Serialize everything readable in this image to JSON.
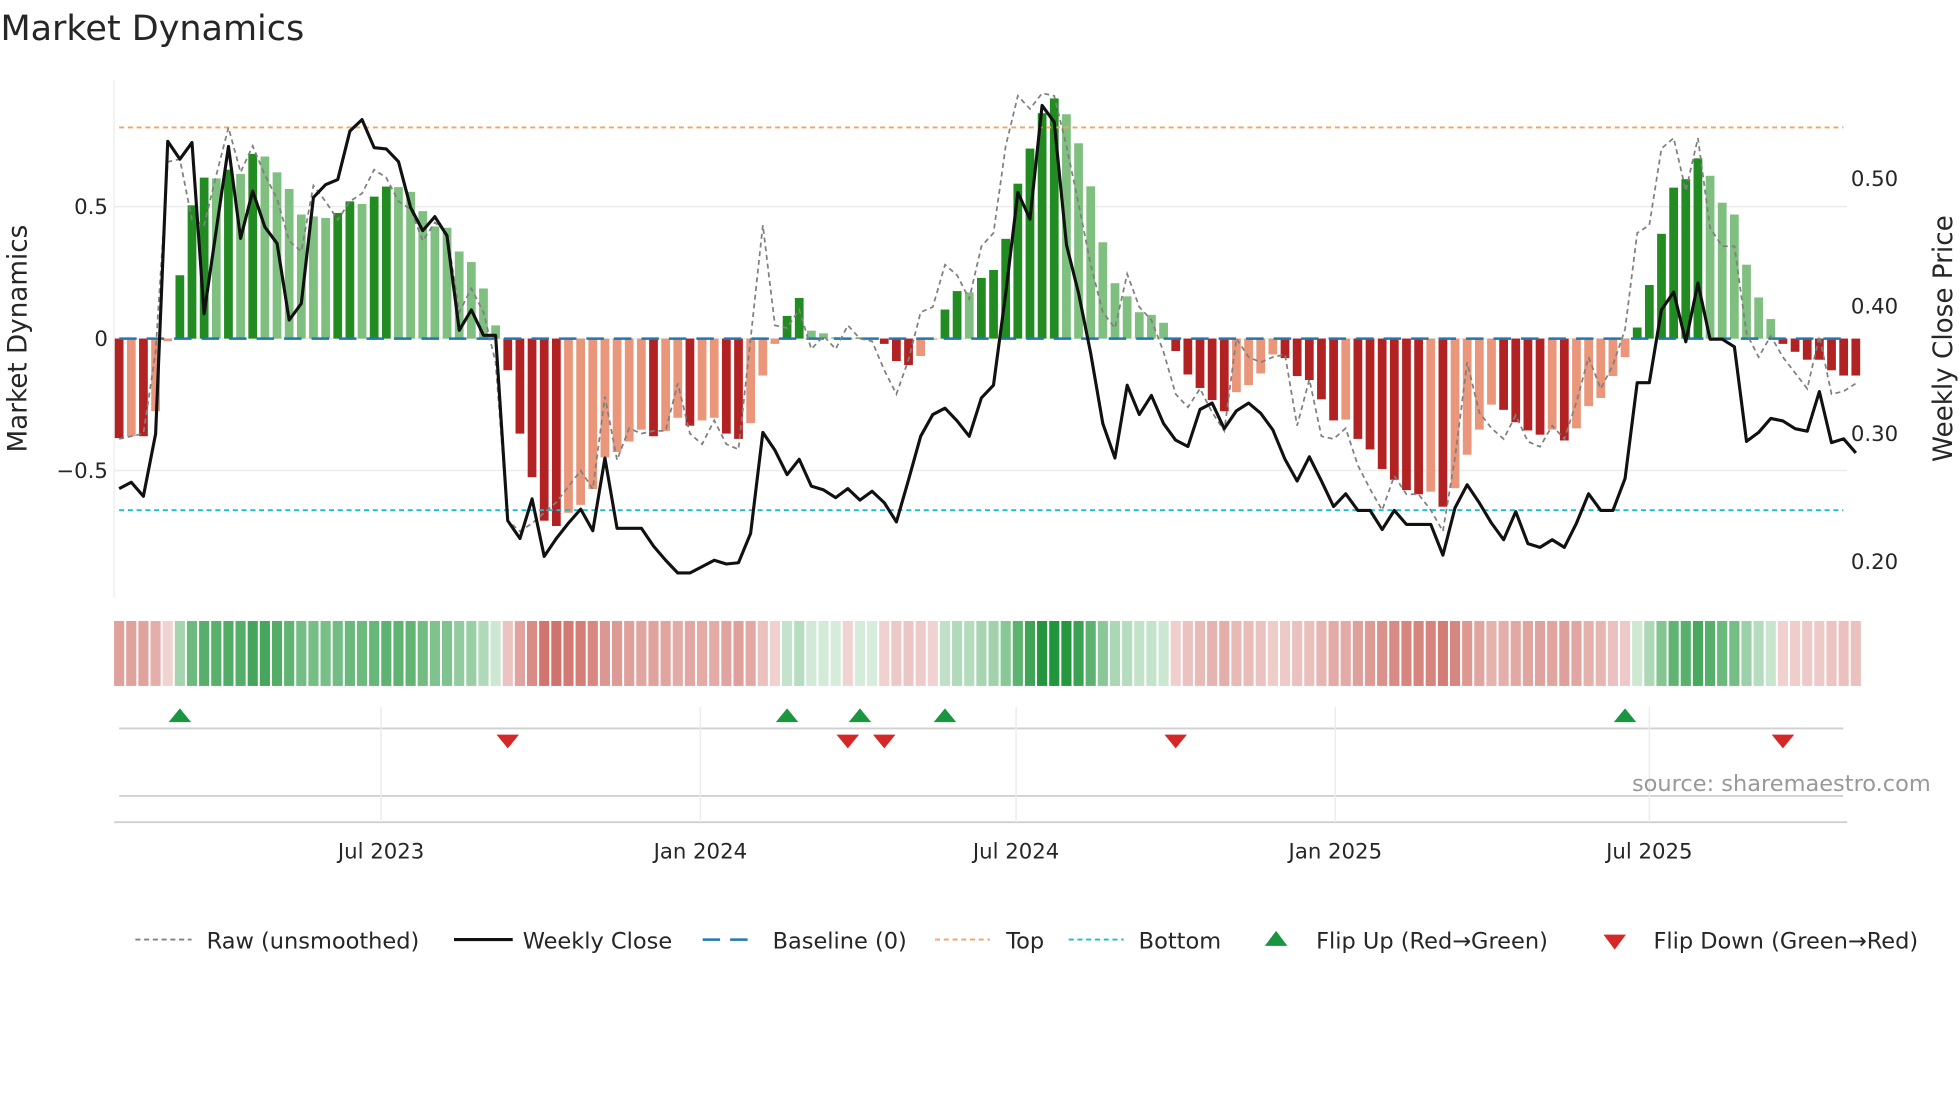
{
  "chart_data": {
    "type": "bar",
    "title": "Market Dynamics",
    "ylabel": "Market Dynamics",
    "y2label": "Weekly Close Price",
    "source": "source: sharemaestro.com",
    "x_start": "2023-01-31",
    "x_step_days": 7,
    "ylim": [
      -0.98,
      0.98
    ],
    "y2lim": [
      0.172,
      0.577
    ],
    "yticks": [
      {
        "v": 0.5,
        "label": "0.5"
      },
      {
        "v": 0,
        "label": "0"
      },
      {
        "v": -0.5,
        "label": "−0.5"
      }
    ],
    "y2ticks": [
      {
        "v": 0.5,
        "label": "0.50"
      },
      {
        "v": 0.4,
        "label": "0.40"
      },
      {
        "v": 0.3,
        "label": "0.30"
      },
      {
        "v": 0.2,
        "label": "0.20"
      }
    ],
    "xticks": [
      {
        "date": "2023-07-01",
        "label": "Jul 2023"
      },
      {
        "date": "2024-01-01",
        "label": "Jan 2024"
      },
      {
        "date": "2024-07-01",
        "label": "Jul 2024"
      },
      {
        "date": "2025-01-01",
        "label": "Jan 2025"
      },
      {
        "date": "2025-07-01",
        "label": "Jul 2025"
      }
    ],
    "top_level": 0.8,
    "bottom_level": -0.65,
    "baseline": 0,
    "colors": {
      "up_strong": "#228b22",
      "up_weak": "#7fbf7f",
      "down_strong": "#b22222",
      "down_weak": "#e9967a",
      "top": "#f4a460",
      "bottom": "#17becf",
      "baseline": "#1f77b4",
      "flip_up": "#1a9641",
      "flip_down": "#d62728"
    },
    "dynamics": [
      -0.377,
      -0.37,
      -0.37,
      -0.275,
      -0.01,
      0.24,
      0.505,
      0.61,
      0.607,
      0.64,
      0.624,
      0.7,
      0.69,
      0.63,
      0.567,
      0.47,
      0.463,
      0.457,
      0.476,
      0.52,
      0.51,
      0.538,
      0.576,
      0.574,
      0.556,
      0.483,
      0.425,
      0.42,
      0.33,
      0.29,
      0.19,
      0.05,
      -0.12,
      -0.36,
      -0.525,
      -0.69,
      -0.71,
      -0.66,
      -0.63,
      -0.57,
      -0.45,
      -0.43,
      -0.39,
      -0.345,
      -0.37,
      -0.35,
      -0.3,
      -0.33,
      -0.31,
      -0.3,
      -0.36,
      -0.38,
      -0.32,
      -0.14,
      -0.02,
      0.086,
      0.154,
      0.03,
      0.02,
      0.005,
      -0.003,
      0.004,
      0.002,
      -0.02,
      -0.085,
      -0.1,
      -0.066,
      -0.004,
      0.11,
      0.18,
      0.175,
      0.23,
      0.26,
      0.378,
      0.587,
      0.72,
      0.854,
      0.91,
      0.85,
      0.74,
      0.577,
      0.365,
      0.21,
      0.16,
      0.1,
      0.09,
      0.06,
      -0.047,
      -0.136,
      -0.187,
      -0.233,
      -0.275,
      -0.203,
      -0.176,
      -0.132,
      -0.06,
      -0.074,
      -0.142,
      -0.157,
      -0.23,
      -0.31,
      -0.307,
      -0.38,
      -0.42,
      -0.494,
      -0.535,
      -0.574,
      -0.59,
      -0.58,
      -0.637,
      -0.567,
      -0.44,
      -0.345,
      -0.25,
      -0.27,
      -0.317,
      -0.348,
      -0.364,
      -0.345,
      -0.386,
      -0.34,
      -0.256,
      -0.225,
      -0.142,
      -0.07,
      0.042,
      0.203,
      0.397,
      0.572,
      0.604,
      0.683,
      0.617,
      0.515,
      0.47,
      0.28,
      0.156,
      0.074,
      -0.02,
      -0.05,
      -0.08,
      -0.08,
      -0.12,
      -0.14,
      -0.14
    ],
    "raw": [
      -0.38,
      -0.37,
      -0.36,
      -0.05,
      0.67,
      0.68,
      0.45,
      0.43,
      0.62,
      0.8,
      0.63,
      0.73,
      0.62,
      0.53,
      0.37,
      0.33,
      0.58,
      0.52,
      0.45,
      0.52,
      0.55,
      0.64,
      0.61,
      0.52,
      0.49,
      0.37,
      0.44,
      0.4,
      0.1,
      0.19,
      0.1,
      -0.09,
      -0.69,
      -0.73,
      -0.7,
      -0.66,
      -0.62,
      -0.56,
      -0.5,
      -0.57,
      -0.22,
      -0.46,
      -0.34,
      -0.36,
      -0.35,
      -0.35,
      -0.17,
      -0.36,
      -0.4,
      -0.31,
      -0.4,
      -0.42,
      0.0,
      0.43,
      0.05,
      0.04,
      0.11,
      -0.04,
      0.01,
      -0.04,
      0.05,
      0.0,
      -0.01,
      -0.12,
      -0.21,
      -0.08,
      0.1,
      0.12,
      0.28,
      0.24,
      0.15,
      0.35,
      0.4,
      0.73,
      0.92,
      0.87,
      0.93,
      0.92,
      0.73,
      0.51,
      0.28,
      0.1,
      0.04,
      0.245,
      0.12,
      0.07,
      -0.05,
      -0.21,
      -0.26,
      -0.19,
      -0.28,
      -0.35,
      0.0,
      -0.07,
      -0.09,
      -0.07,
      -0.06,
      -0.33,
      -0.155,
      -0.37,
      -0.38,
      -0.34,
      -0.48,
      -0.57,
      -0.65,
      -0.52,
      -0.59,
      -0.59,
      -0.65,
      -0.73,
      -0.45,
      -0.09,
      -0.28,
      -0.34,
      -0.38,
      -0.29,
      -0.39,
      -0.41,
      -0.33,
      -0.38,
      -0.24,
      -0.07,
      -0.19,
      -0.1,
      0.035,
      0.4,
      0.43,
      0.72,
      0.76,
      0.56,
      0.76,
      0.42,
      0.35,
      0.35,
      0.02,
      -0.07,
      0.01,
      -0.07,
      -0.13,
      -0.19,
      0.01,
      -0.21,
      -0.2,
      -0.17
    ],
    "close": [
      0.257,
      0.262,
      0.251,
      0.3,
      0.529,
      0.515,
      0.528,
      0.394,
      0.46,
      0.525,
      0.453,
      0.49,
      0.462,
      0.449,
      0.389,
      0.402,
      0.485,
      0.495,
      0.499,
      0.537,
      0.546,
      0.524,
      0.523,
      0.513,
      0.477,
      0.459,
      0.47,
      0.455,
      0.381,
      0.397,
      0.377,
      0.377,
      0.232,
      0.218,
      0.249,
      0.204,
      0.218,
      0.23,
      0.241,
      0.224,
      0.281,
      0.226,
      0.226,
      0.226,
      0.212,
      0.201,
      0.191,
      0.191,
      0.196,
      0.201,
      0.198,
      0.199,
      0.222,
      0.301,
      0.287,
      0.268,
      0.28,
      0.259,
      0.256,
      0.25,
      0.257,
      0.248,
      0.255,
      0.246,
      0.231,
      0.264,
      0.298,
      0.315,
      0.32,
      0.31,
      0.298,
      0.328,
      0.338,
      0.41,
      0.489,
      0.468,
      0.557,
      0.544,
      0.448,
      0.41,
      0.363,
      0.308,
      0.281,
      0.338,
      0.315,
      0.33,
      0.308,
      0.295,
      0.29,
      0.319,
      0.324,
      0.304,
      0.318,
      0.324,
      0.316,
      0.303,
      0.28,
      0.263,
      0.282,
      0.263,
      0.243,
      0.253,
      0.24,
      0.24,
      0.225,
      0.24,
      0.229,
      0.229,
      0.229,
      0.205,
      0.242,
      0.26,
      0.246,
      0.23,
      0.217,
      0.239,
      0.214,
      0.211,
      0.217,
      0.211,
      0.23,
      0.253,
      0.24,
      0.24,
      0.265,
      0.34,
      0.34,
      0.397,
      0.411,
      0.372,
      0.418,
      0.374,
      0.374,
      0.368,
      0.294,
      0.301,
      0.312,
      0.31,
      0.304,
      0.302,
      0.333,
      0.293,
      0.296,
      0.285
    ],
    "flips_up_index": [
      5,
      55,
      61,
      68,
      124
    ],
    "flips_down_index": [
      32,
      60,
      63,
      87,
      137
    ],
    "legend": {
      "raw": "Raw (unsmoothed)",
      "close": "Weekly Close",
      "baseline": "Baseline (0)",
      "top": "Top",
      "bottom": "Bottom",
      "flip_up": "Flip Up (Red→Green)",
      "flip_down": "Flip Down (Green→Red)"
    },
    "legend_placement": "bottom"
  }
}
